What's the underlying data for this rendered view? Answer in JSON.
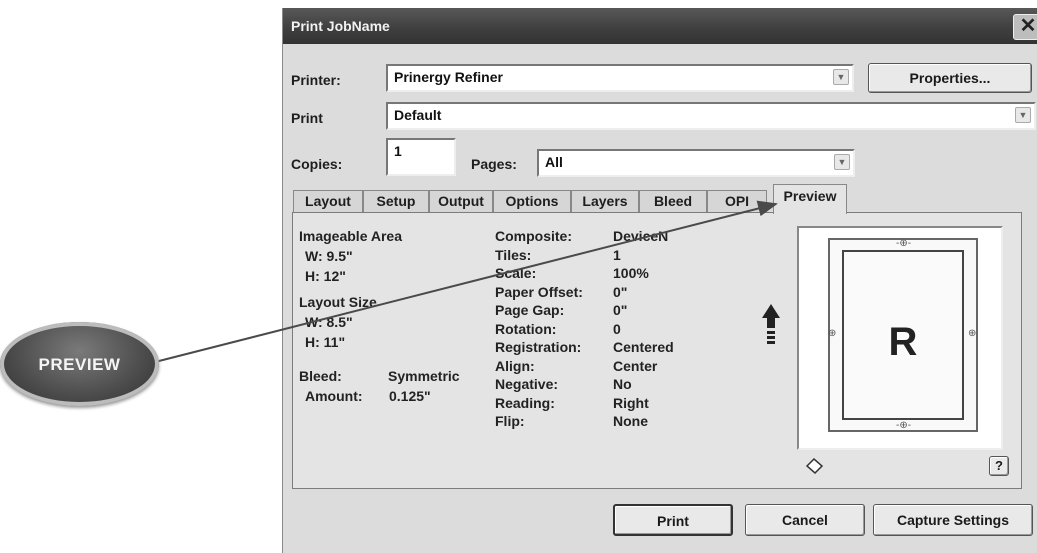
{
  "window": {
    "title": "Print JobName",
    "close_glyph": "✕"
  },
  "printer": {
    "label": "Printer:",
    "value": "Prinergy Refiner",
    "properties_button": "Properties..."
  },
  "print_field": {
    "label": "Print",
    "value": "Default"
  },
  "copies": {
    "label": "Copies:",
    "value": "1"
  },
  "pages": {
    "label": "Pages:",
    "value": "All"
  },
  "tabs": [
    "Layout",
    "Setup",
    "Output",
    "Options",
    "Layers",
    "Bleed",
    "OPI",
    "Preview"
  ],
  "active_tab": "Preview",
  "left_info": {
    "imageable_area": "Imageable Area",
    "imageable_w": "W: 9.5\"",
    "imageable_h": "H: 12\"",
    "layout_size": "Layout Size",
    "layout_w": "W: 8.5\"",
    "layout_h": "H: 11\"",
    "bleed_label": "Bleed:",
    "bleed_value": "Symmetric",
    "amount_label": "Amount:",
    "amount_value": "0.125\""
  },
  "settings": [
    {
      "label": "Composite:",
      "value": "DeviceN"
    },
    {
      "label": "Tiles:",
      "value": "1"
    },
    {
      "label": "Scale:",
      "value": "100%"
    },
    {
      "label": "Paper Offset:",
      "value": "0\""
    },
    {
      "label": "Page Gap:",
      "value": "0\""
    },
    {
      "label": "Rotation:",
      "value": "0"
    },
    {
      "label": "Registration:",
      "value": "Centered"
    },
    {
      "label": "Align:",
      "value": "Center"
    },
    {
      "label": "Negative:",
      "value": "No"
    },
    {
      "label": "Reading:",
      "value": "Right"
    },
    {
      "label": "Flip:",
      "value": "None"
    }
  ],
  "preview": {
    "page_letter": "R",
    "help_button": "?"
  },
  "buttons": {
    "print": "Print",
    "cancel": "Cancel",
    "capture": "Capture Settings"
  },
  "callout": {
    "label": "PREVIEW"
  },
  "icons": [
    "close-icon",
    "dropdown-arrow-icon",
    "feed-direction-arrow-icon",
    "eraser-icon",
    "help-icon",
    "registration-mark-icon"
  ]
}
